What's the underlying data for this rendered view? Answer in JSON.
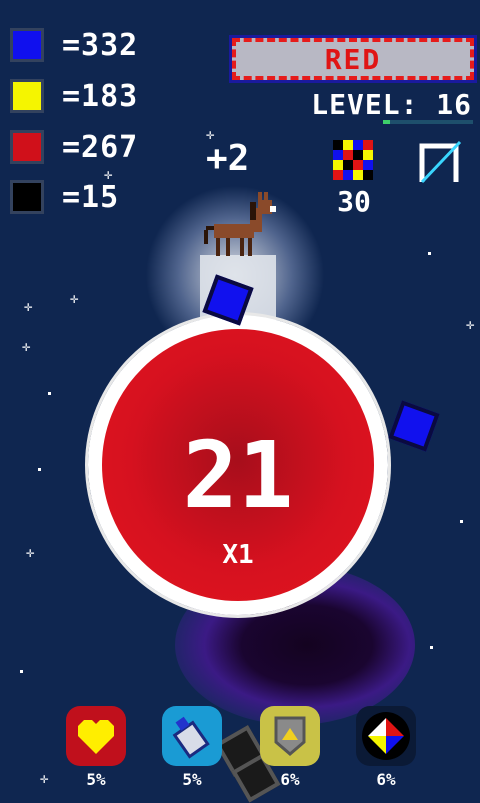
{
  "counters": [
    {
      "color_name": "blue",
      "color": "#1010ee",
      "value": "=332"
    },
    {
      "color_name": "yellow",
      "color": "#f5f500",
      "value": "=183"
    },
    {
      "color_name": "red",
      "color": "#d0101a",
      "value": "=267"
    },
    {
      "color_name": "black",
      "color": "#000000",
      "value": "=15"
    }
  ],
  "target": {
    "label": "RED"
  },
  "level": {
    "label": "LEVEL: 16",
    "progress": 0.08
  },
  "bonus": "+2",
  "pattern": {
    "count": "30",
    "icon": "checkered-color-pattern-icon"
  },
  "tool": {
    "icon": "bow-icon"
  },
  "planet": {
    "score": "21",
    "multiplier": "X1"
  },
  "powerups": [
    {
      "name": "heart",
      "icon": "heart-icon",
      "color": "#c0101c",
      "percent": "5%"
    },
    {
      "name": "spray",
      "icon": "spray-can-icon",
      "color": "#1a9bd4",
      "percent": "5%"
    },
    {
      "name": "shield",
      "icon": "shield-icon",
      "color": "#c9c247",
      "percent": "6%"
    },
    {
      "name": "color-wheel",
      "icon": "color-wheel-icon",
      "color": "#0b1a36",
      "percent": "6%"
    }
  ]
}
